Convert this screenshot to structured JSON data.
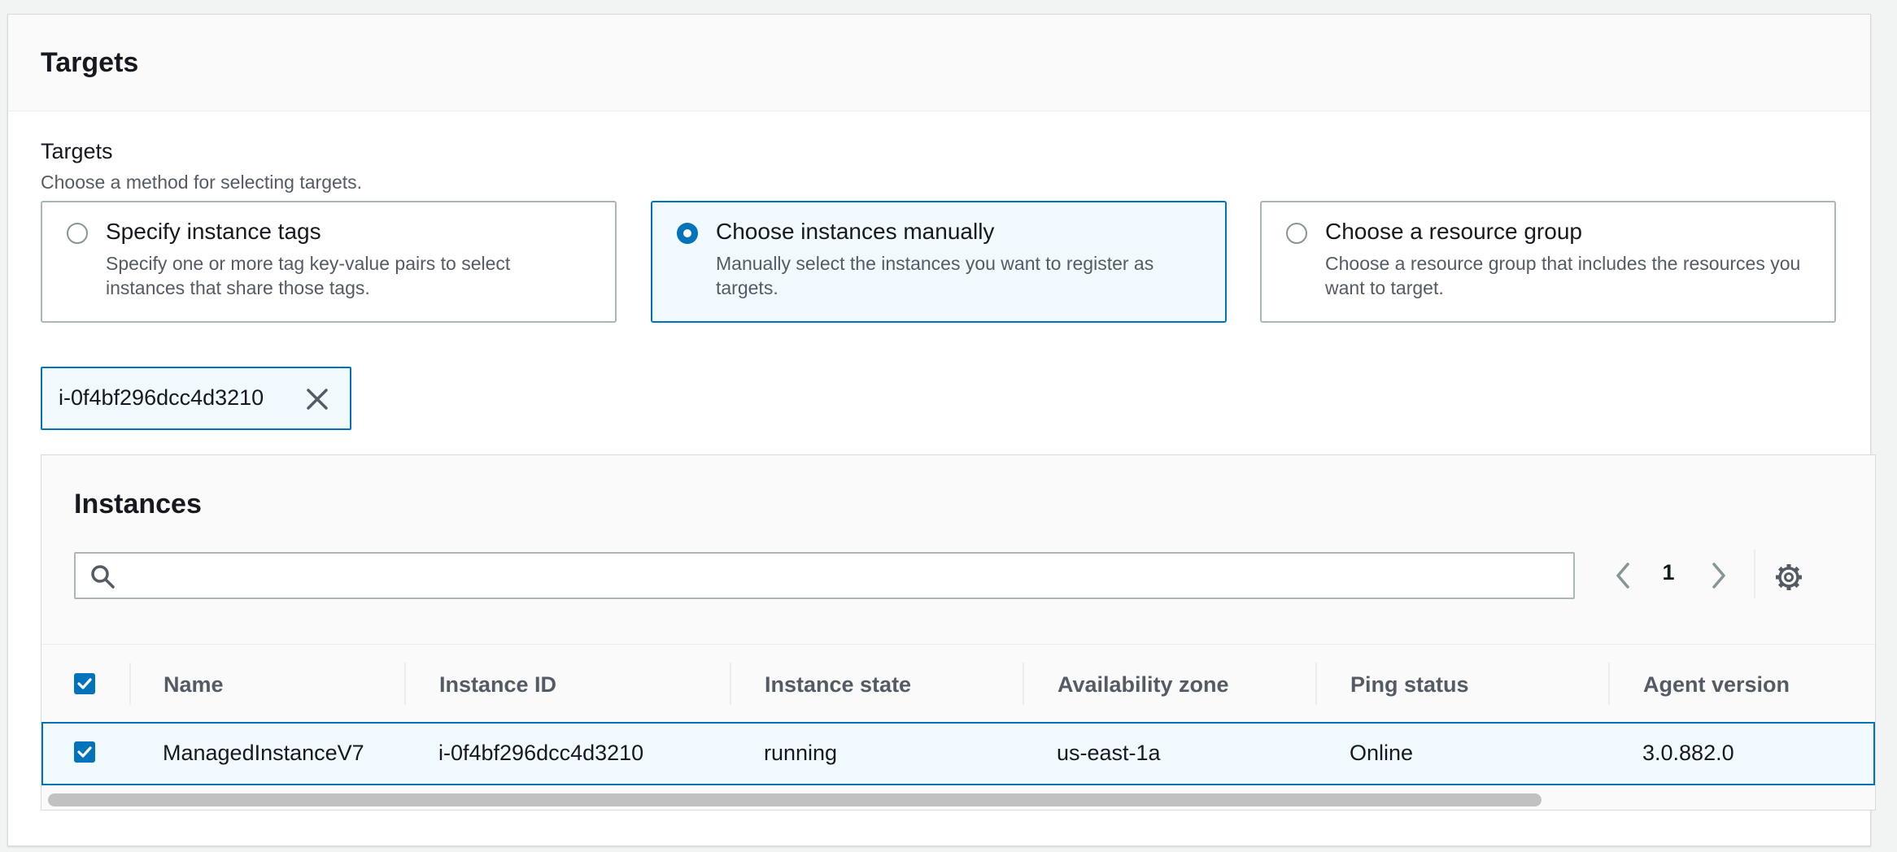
{
  "panel": {
    "title": "Targets"
  },
  "targets_field": {
    "label": "Targets",
    "description": "Choose a method for selecting targets.",
    "options": [
      {
        "title": "Specify instance tags",
        "description": "Specify one or more tag key-value pairs to select instances that share those tags.",
        "selected": false
      },
      {
        "title": "Choose instances manually",
        "description": "Manually select the instances you want to register as targets.",
        "selected": true
      },
      {
        "title": "Choose a resource group",
        "description": "Choose a resource group that includes the resources you want to target.",
        "selected": false
      }
    ]
  },
  "token": {
    "label": "i-0f4bf296dcc4d3210"
  },
  "instances": {
    "title": "Instances",
    "search": {
      "value": "",
      "placeholder": ""
    },
    "pagination": {
      "current_page": "1"
    },
    "columns": [
      "Name",
      "Instance ID",
      "Instance state",
      "Availability zone",
      "Ping status",
      "Agent version"
    ],
    "rows": [
      {
        "selected": true,
        "cells": [
          "ManagedInstanceV7",
          "i-0f4bf296dcc4d3210",
          "running",
          "us-east-1a",
          "Online",
          "3.0.882.0"
        ]
      }
    ],
    "select_all_checked": true
  },
  "colors": {
    "accent": "#0073bb",
    "selected_bg": "#f1faff",
    "border": "#aab7b8",
    "muted_text": "#545b64"
  },
  "icons": [
    "search-icon",
    "close-icon",
    "chevron-left-icon",
    "chevron-right-icon",
    "gear-icon",
    "checkmark-icon"
  ]
}
